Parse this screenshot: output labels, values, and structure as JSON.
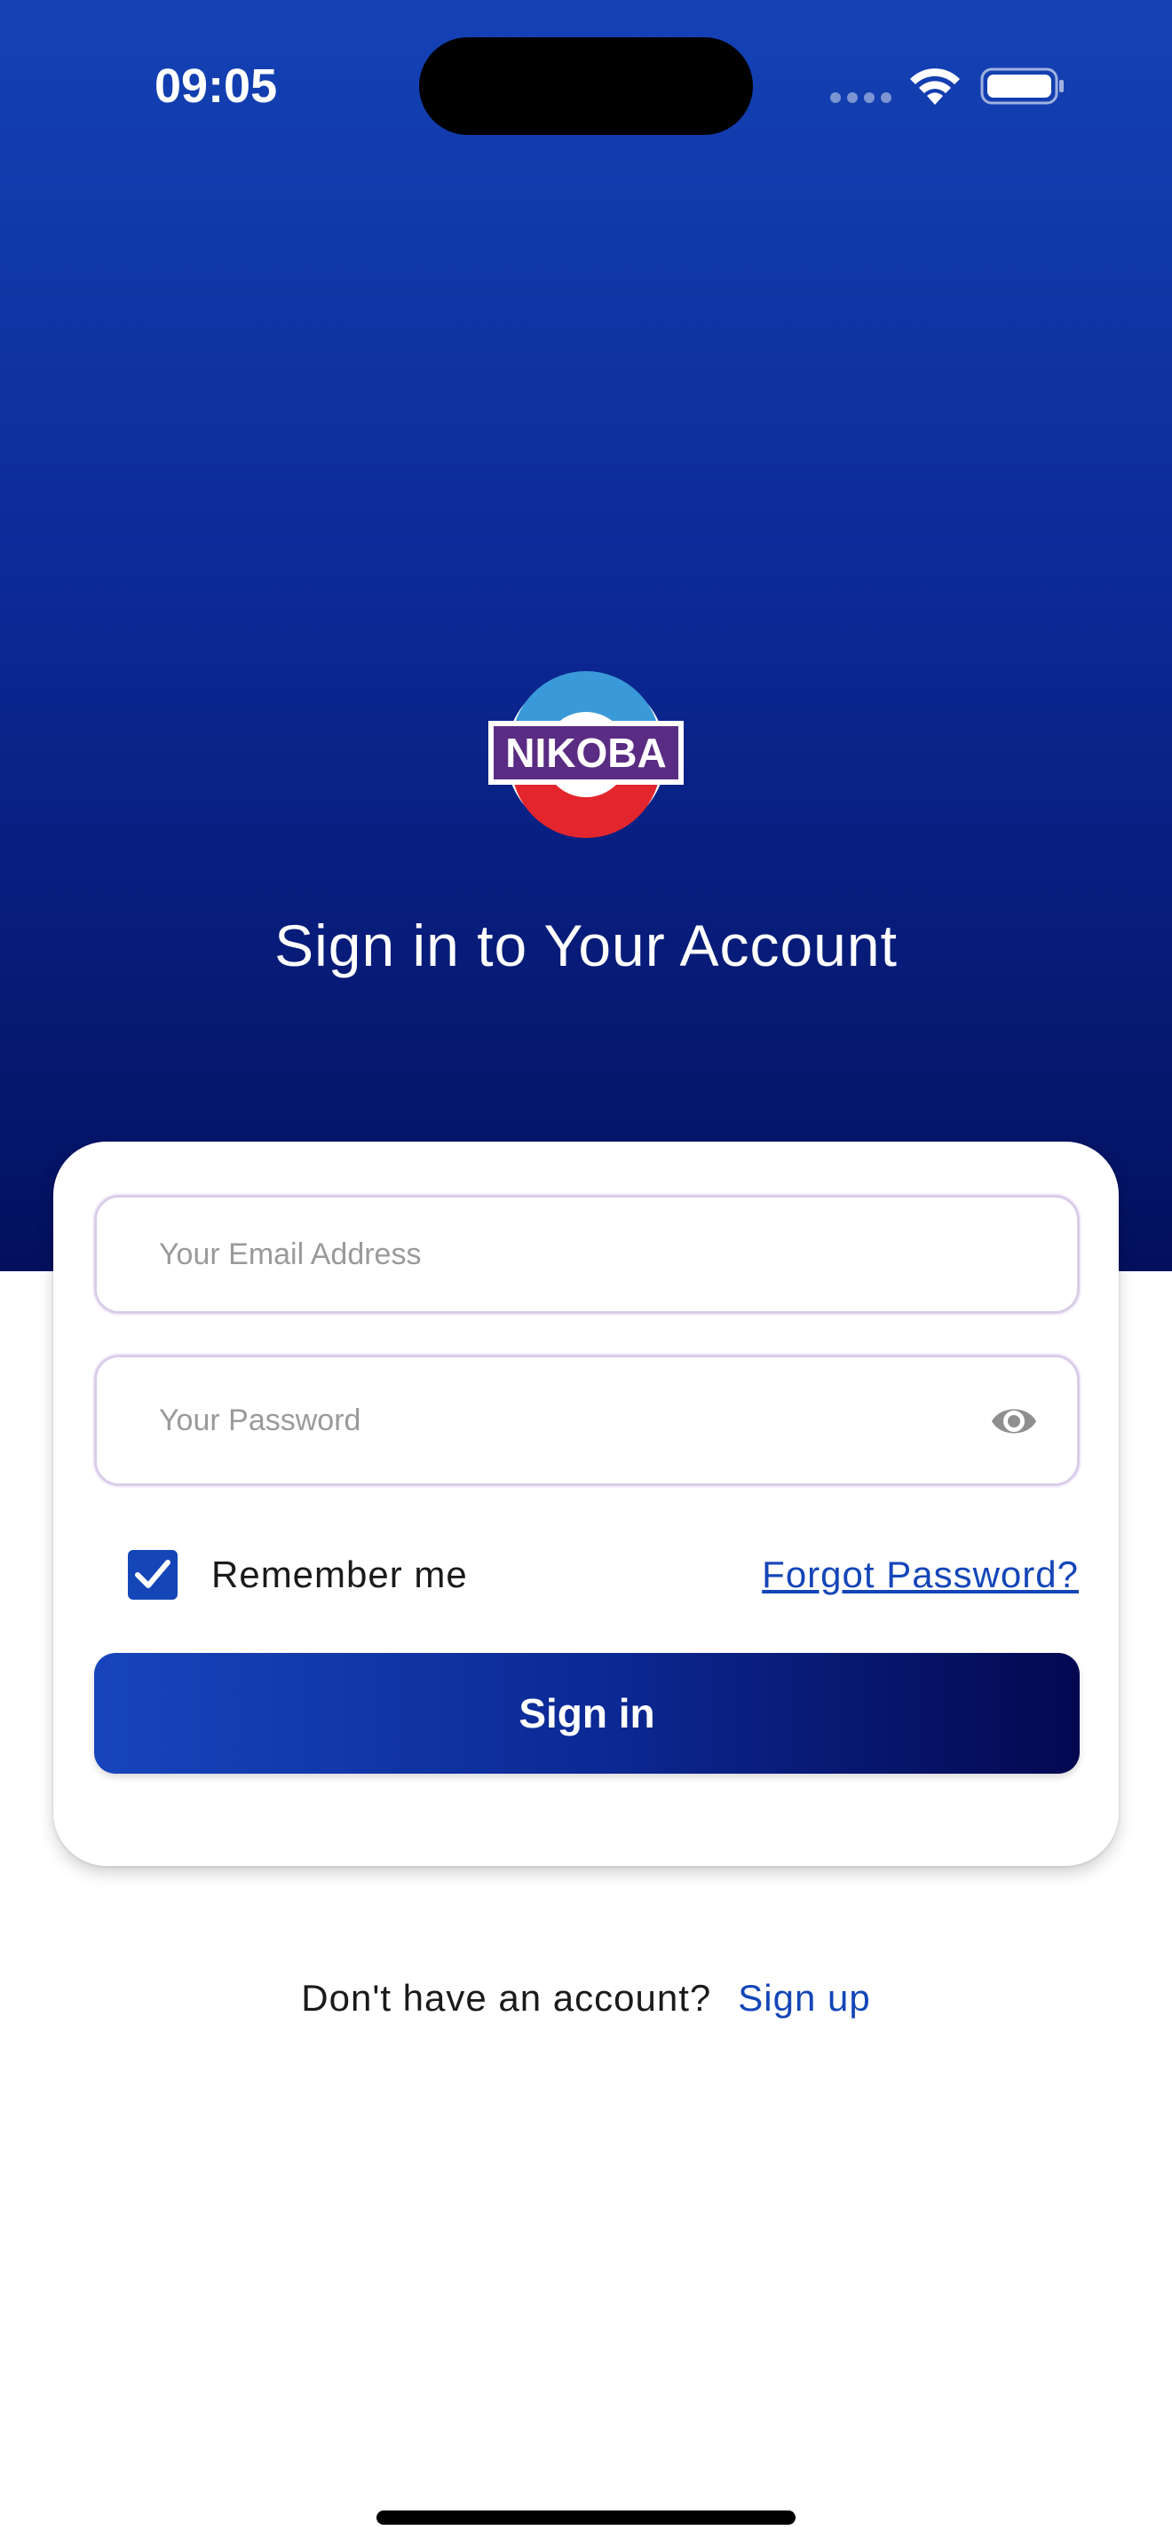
{
  "status_bar": {
    "time": "09:05",
    "icons": [
      "cellular-signal-icon",
      "wifi-icon",
      "battery-icon"
    ]
  },
  "brand": {
    "logo_text": "NIKOBA",
    "logo_colors": {
      "top": "#3a9ad9",
      "bottom": "#e3262d",
      "banner": "#5b2c83"
    }
  },
  "header": {
    "title": "Sign in to Your Account"
  },
  "form": {
    "email_placeholder": "Your Email Address",
    "email_value": "",
    "password_placeholder": "Your Password",
    "password_value": "",
    "password_toggle_icon": "eye-icon",
    "remember_label": "Remember me",
    "remember_checked": true,
    "forgot_label": "Forgot Password?",
    "submit_label": "Sign in"
  },
  "footer": {
    "prompt": "Don't have an account?",
    "signup_label": "Sign up"
  },
  "colors": {
    "accent": "#1446b8",
    "gradient_top": "#1442b5",
    "gradient_bottom": "#03105e"
  }
}
